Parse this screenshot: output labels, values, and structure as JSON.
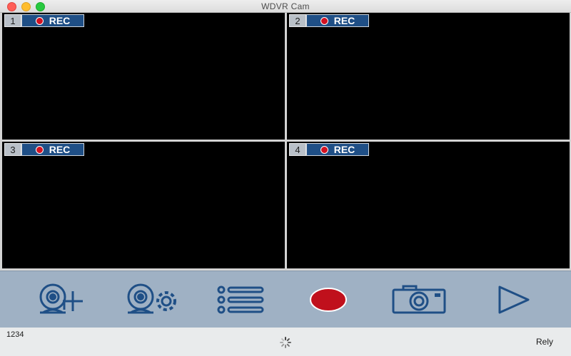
{
  "window": {
    "title": "WDVR Cam"
  },
  "cameras": [
    {
      "number": "1",
      "rec_label": "REC"
    },
    {
      "number": "2",
      "rec_label": "REC"
    },
    {
      "number": "3",
      "rec_label": "REC"
    },
    {
      "number": "4",
      "rec_label": "REC"
    }
  ],
  "toolbar": {
    "icons": [
      "add-camera-icon",
      "camera-settings-icon",
      "list-icon",
      "record-icon",
      "snapshot-icon",
      "play-icon"
    ],
    "accent_color": "#1f4f86",
    "record_color": "#c0101c"
  },
  "status": {
    "left_text": "1234",
    "right_text": "Rely"
  }
}
